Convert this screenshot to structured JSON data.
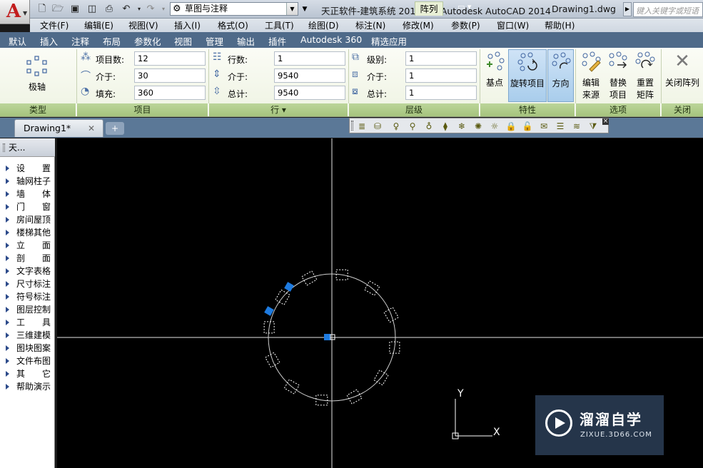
{
  "app": {
    "logo_letter": "A"
  },
  "title_bar": {
    "workspace": "草图与注释",
    "title": "天正软件-建筑系统 2014  For Autodesk AutoCAD 2014",
    "file": "Drawing1.dwg",
    "search_placeholder": "键入关键字或短语"
  },
  "menus": [
    "文件(F)",
    "编辑(E)",
    "视图(V)",
    "插入(I)",
    "格式(O)",
    "工具(T)",
    "绘图(D)",
    "标注(N)",
    "修改(M)",
    "参数(P)",
    "窗口(W)",
    "帮助(H)"
  ],
  "ribbon_tabs": [
    "默认",
    "插入",
    "注释",
    "布局",
    "参数化",
    "视图",
    "管理",
    "输出",
    "插件",
    "Autodesk 360",
    "精选应用"
  ],
  "ribbon_active_tab": "阵列",
  "ribbon": {
    "type_panel": {
      "button": "极轴",
      "footer": "类型"
    },
    "items_panel": {
      "footer": "项目",
      "count_label": "项目数:",
      "count": "12",
      "between_label": "介于:",
      "between": "30",
      "fill_label": "填充:",
      "fill": "360"
    },
    "rows_panel": {
      "footer": "行 ▾",
      "rows_label": "行数:",
      "rows": "1",
      "between_label": "介于:",
      "between": "9540",
      "total_label": "总计:",
      "total": "9540"
    },
    "levels_panel": {
      "footer": "层级",
      "levels_label": "级别:",
      "levels": "1",
      "between_label": "介于:",
      "between": "1",
      "total_label": "总计:",
      "total": "1"
    },
    "properties_panel": {
      "footer": "特性",
      "base_point": "基点",
      "rotate_items": "旋转项目",
      "direction": "方向"
    },
    "options_panel": {
      "footer": "选项",
      "edit_source_1": "编辑",
      "edit_source_2": "来源",
      "replace_1": "替换",
      "replace_2": "项目",
      "reset_1": "重置",
      "reset_2": "矩阵"
    },
    "close_panel": {
      "footer": "关闭",
      "close": "关闭阵列"
    }
  },
  "doc_tab": {
    "name": "Drawing1*"
  },
  "palette": {
    "title": "天...",
    "items": [
      "设　　置",
      "轴网柱子",
      "墙　　体",
      "门　　窗",
      "房间屋顶",
      "楼梯其他",
      "立　　面",
      "剖　　面",
      "文字表格",
      "尺寸标注",
      "符号标注",
      "图层控制",
      "工　　具",
      "三维建模",
      "图块图案",
      "文件布图",
      "其　　它",
      "帮助演示"
    ]
  },
  "canvas": {
    "ucs_y": "Y",
    "ucs_x": "X",
    "array_count": 12
  },
  "watermark": {
    "title": "溜溜自学",
    "url": "ZIXUE.3D66.COM"
  },
  "colors": {
    "ribbon_footer": "#a5c47d",
    "tab_bar": "#4f6a89",
    "canvas": "#000000",
    "grip_selected": "#1e7be0"
  }
}
